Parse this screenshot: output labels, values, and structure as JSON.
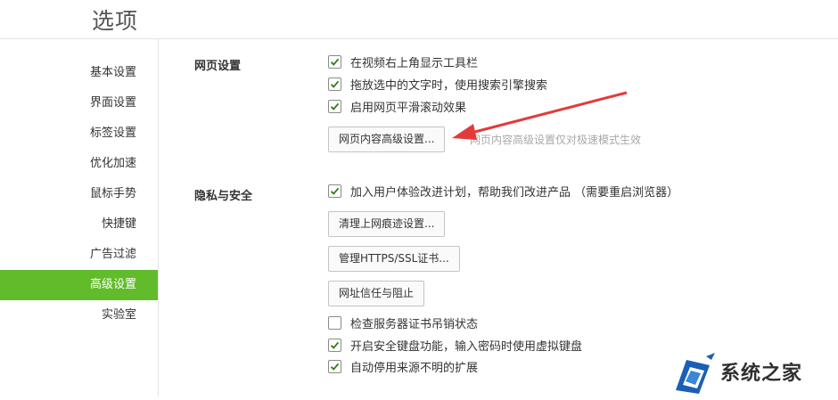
{
  "window": {
    "title": "选项"
  },
  "sidebar": {
    "items": [
      {
        "label": "基本设置",
        "active": false
      },
      {
        "label": "界面设置",
        "active": false
      },
      {
        "label": "标签设置",
        "active": false
      },
      {
        "label": "优化加速",
        "active": false
      },
      {
        "label": "鼠标手势",
        "active": false
      },
      {
        "label": "快捷键",
        "active": false
      },
      {
        "label": "广告过滤",
        "active": false
      },
      {
        "label": "高级设置",
        "active": true
      },
      {
        "label": "实验室",
        "active": false
      }
    ]
  },
  "webpage": {
    "title": "网页设置",
    "options": [
      {
        "label": "在视频右上角显示工具栏",
        "checked": true
      },
      {
        "label": "拖放选中的文字时，使用搜索引擎搜索",
        "checked": true
      },
      {
        "label": "启用网页平滑滚动效果",
        "checked": true
      }
    ],
    "advanced_button": "网页内容高级设置...",
    "hint": "网页内容高级设置仅对极速模式生效"
  },
  "privacy": {
    "title": "隐私与安全",
    "join_program": {
      "label": "加入用户体验改进计划，帮助我们改进产品 （需要重启浏览器）",
      "checked": true
    },
    "clear_traces_button": "清理上网痕迹设置...",
    "https_button": "管理HTTPS/SSL证书...",
    "trust_button": "网址信任与阻止",
    "options": [
      {
        "label": "检查服务器证书吊销状态",
        "checked": false
      },
      {
        "label": "开启安全键盘功能，输入密码时使用虚拟键盘",
        "checked": true
      },
      {
        "label": "自动停用来源不明的扩展",
        "checked": true
      }
    ]
  },
  "watermark": {
    "text": "系统之家"
  },
  "colors": {
    "accent": "#62bb2a",
    "arrow": "#e23b3b",
    "watermark_blue": "#1a5fb4"
  }
}
